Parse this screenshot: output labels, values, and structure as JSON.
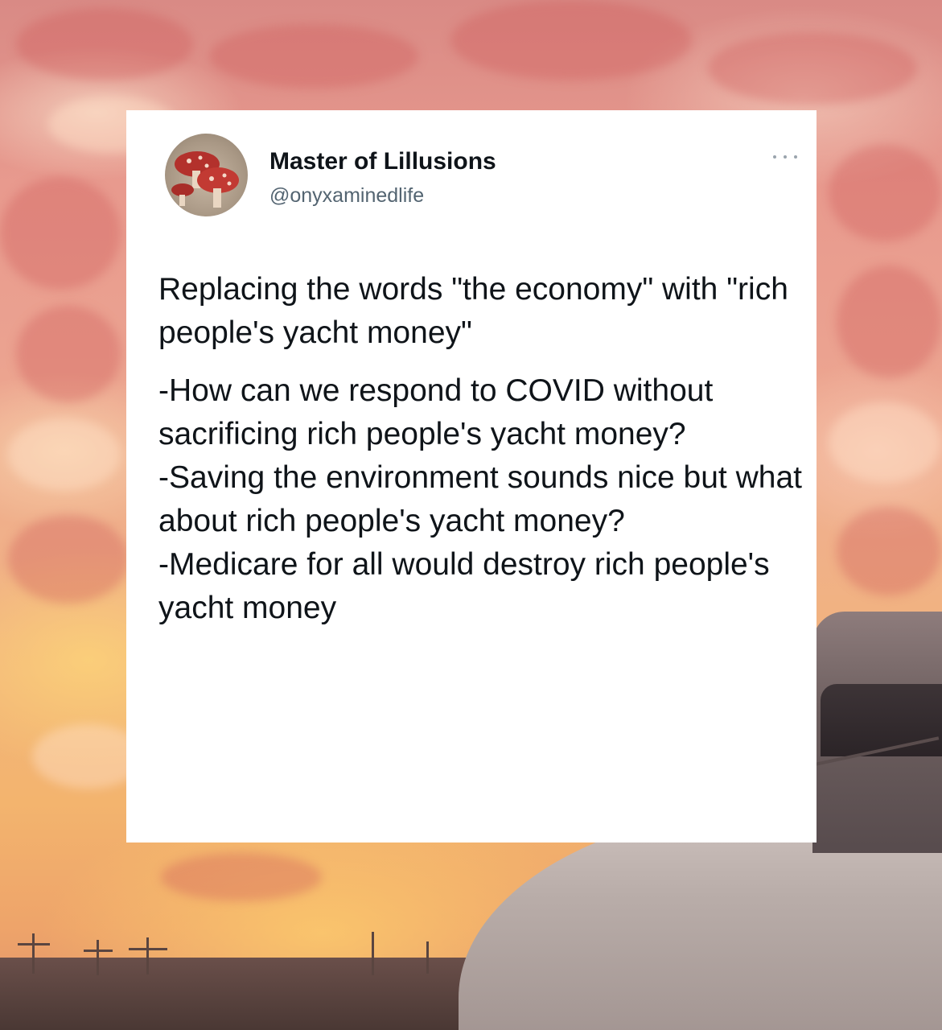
{
  "tweet": {
    "author_name": "Master of Lillusions",
    "author_handle": "@onyxaminedlife",
    "avatar_icon": "mushroom-avatar-icon",
    "more_icon": "more-horizontal-icon",
    "intro": "Replacing the words \"the economy\" with \"rich people's yacht money\"",
    "lines": [
      "-How can we respond to COVID without sacrificing rich people's yacht money?",
      "-Saving the environment sounds nice but what about rich people's yacht money?",
      "-Medicare for all would destroy rich people's yacht money"
    ]
  },
  "colors": {
    "card_background": "#ffffff",
    "name_color": "#0f1419",
    "handle_color": "#536471",
    "sky_top": "#d98a85",
    "sky_bottom": "#f3b46e"
  }
}
